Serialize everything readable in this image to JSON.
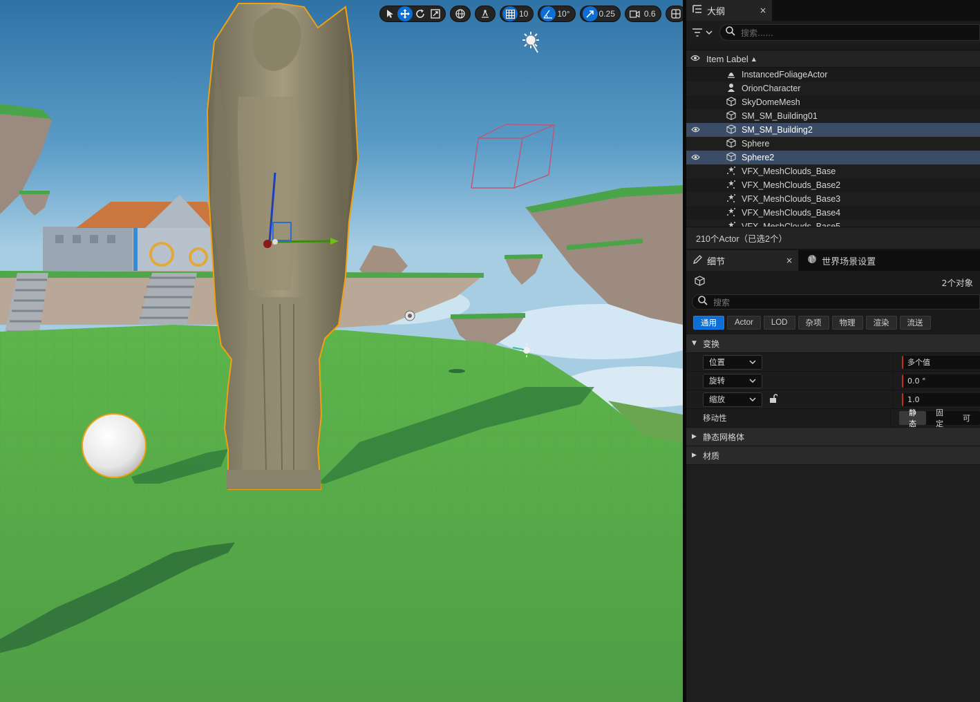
{
  "viewport": {
    "toolbar": {
      "grid_snap_value": "10",
      "rotation_snap_value": "10°",
      "scale_snap_value": "0.25",
      "camera_speed_value": "0.6"
    }
  },
  "outliner": {
    "tab_label": "大纲",
    "close_label": "×",
    "search_placeholder": "搜索......",
    "column_label": "Item Label",
    "items": [
      {
        "label": "InstancedFoliageActor",
        "icon": "foliage-icon",
        "selected": false
      },
      {
        "label": "OrionCharacter",
        "icon": "character-icon",
        "selected": false
      },
      {
        "label": "SkyDomeMesh",
        "icon": "static-mesh-icon",
        "selected": false
      },
      {
        "label": "SM_SM_Building01",
        "icon": "static-mesh-icon",
        "selected": false
      },
      {
        "label": "SM_SM_Building2",
        "icon": "static-mesh-icon",
        "selected": true
      },
      {
        "label": "Sphere",
        "icon": "static-mesh-icon",
        "selected": false
      },
      {
        "label": "Sphere2",
        "icon": "static-mesh-icon",
        "selected": true
      },
      {
        "label": "VFX_MeshClouds_Base",
        "icon": "niagara-icon",
        "selected": false
      },
      {
        "label": "VFX_MeshClouds_Base2",
        "icon": "niagara-icon",
        "selected": false
      },
      {
        "label": "VFX_MeshClouds_Base3",
        "icon": "niagara-icon",
        "selected": false
      },
      {
        "label": "VFX_MeshClouds_Base4",
        "icon": "niagara-icon",
        "selected": false
      },
      {
        "label": "VFX_MeshClouds_Base5",
        "icon": "niagara-icon",
        "selected": false
      }
    ],
    "status": "210个Actor（已选2个）"
  },
  "details": {
    "tab_label": "细节",
    "close_label": "×",
    "world_settings_tab_label": "世界场景设置",
    "object_count": "2个对象",
    "search_placeholder": "搜索",
    "filter_tabs": [
      "通用",
      "Actor",
      "LOD",
      "杂项",
      "物理",
      "渲染",
      "流送"
    ],
    "active_filter_tab": "通用",
    "transform_section": "变换",
    "location_label": "位置",
    "location_value": "多个值",
    "rotation_label": "旋转",
    "rotation_value": "0.0 °",
    "scale_label": "缩放",
    "scale_value": "1.0",
    "mobility_label": "移动性",
    "mobility_options": [
      "静态",
      "固定",
      "可"
    ],
    "mobility_selected": "静态",
    "static_mesh_section": "静态网格体",
    "materials_section": "材质"
  },
  "colors": {
    "accent_blue": "#0d6fd6",
    "selection_orange": "#f0a010",
    "selected_row": "#3b4c66",
    "panel_bg": "#1a1a1a",
    "ground_green": "#56a84a",
    "sky_blue": "#4f8fb8"
  }
}
